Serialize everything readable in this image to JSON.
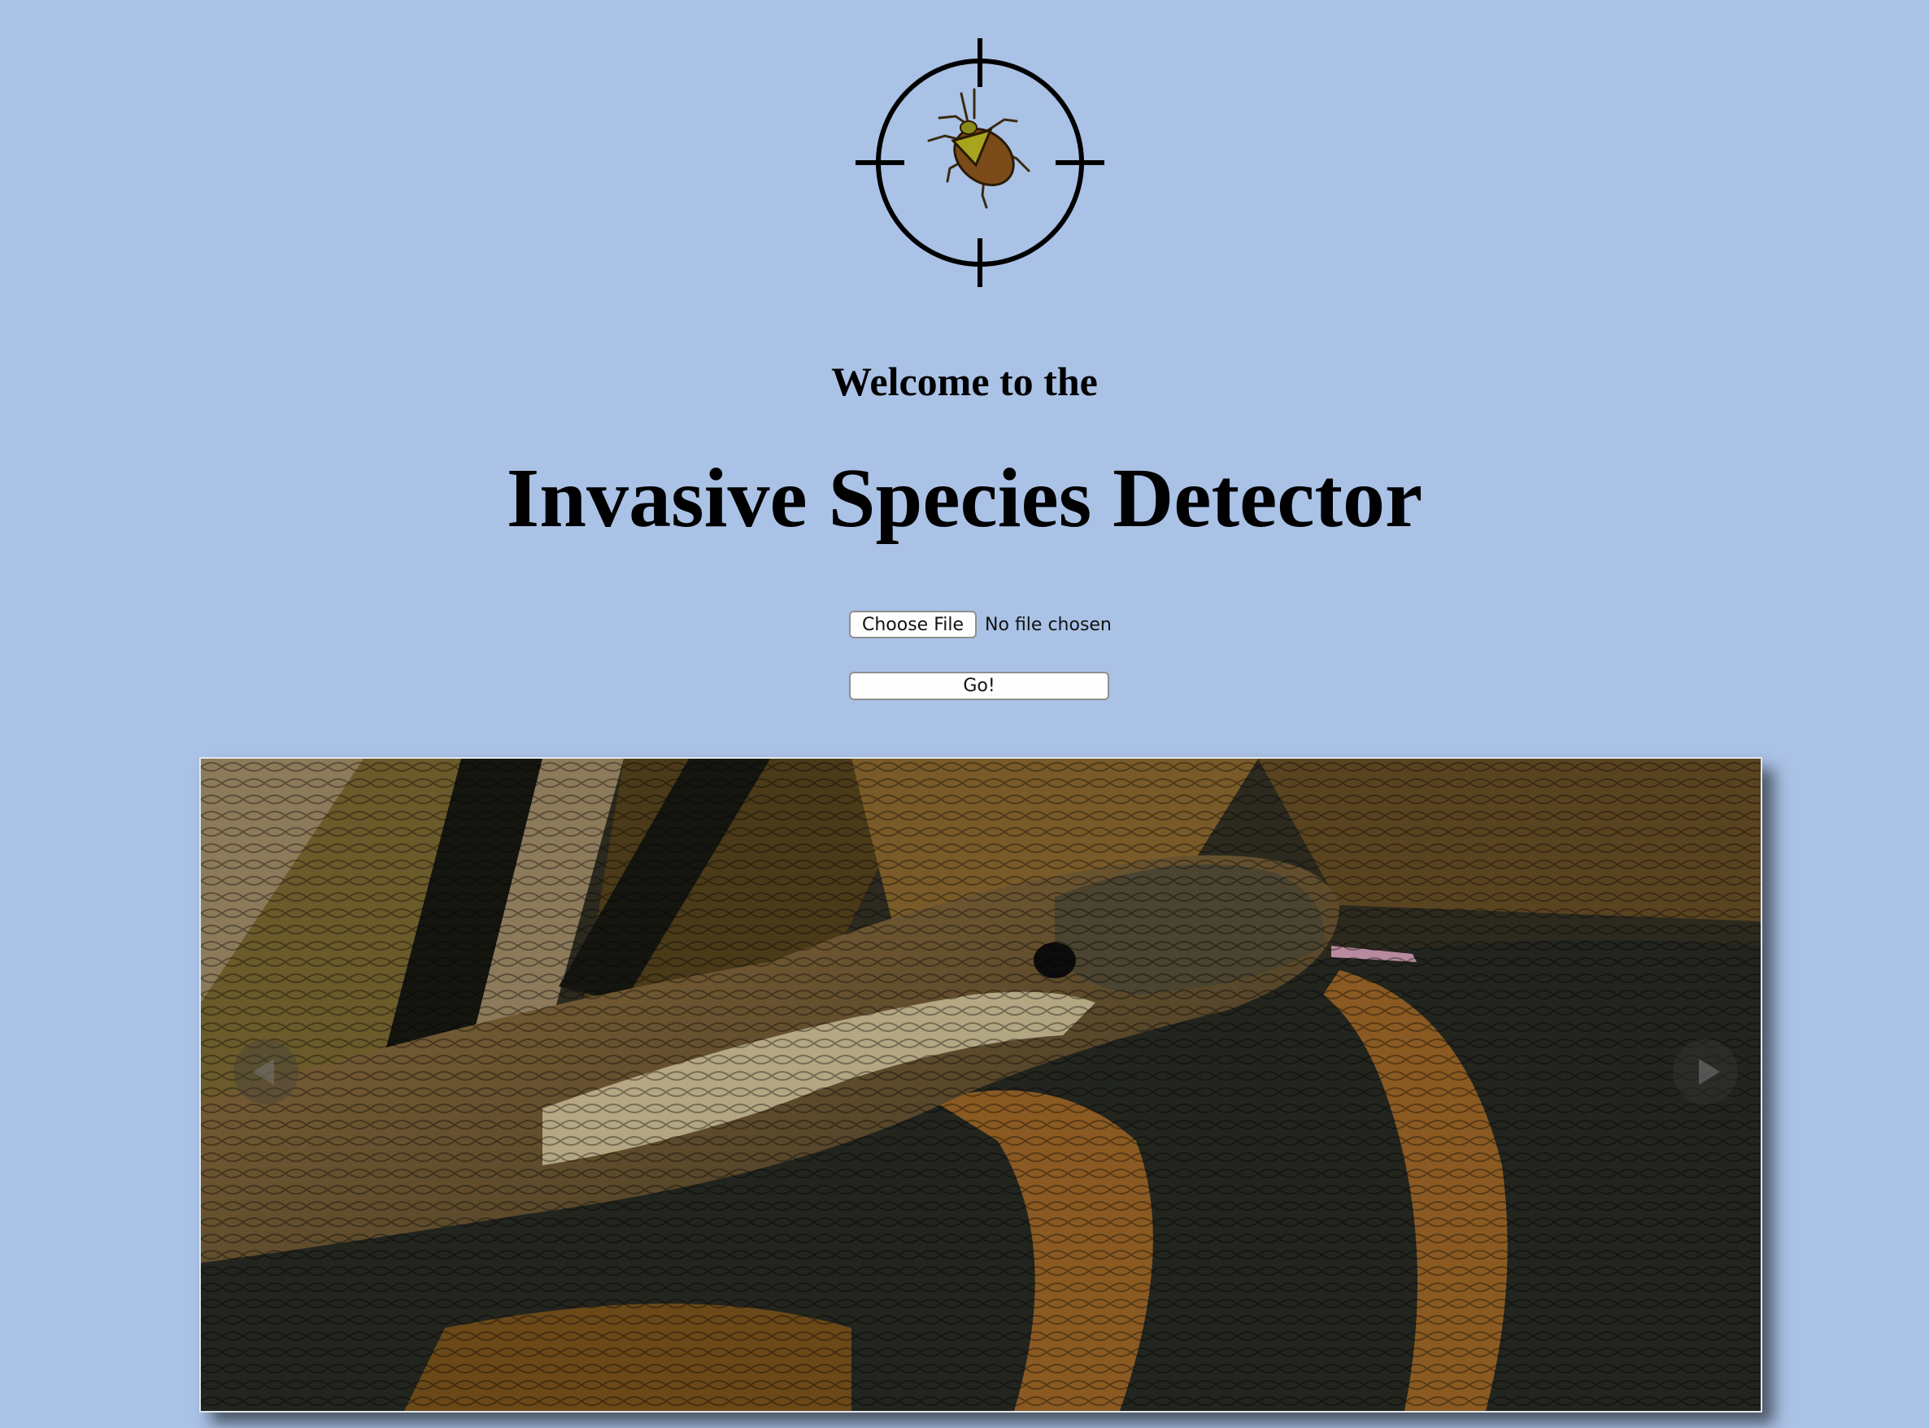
{
  "header": {
    "logo_icon": "bug-crosshair-icon",
    "welcome": "Welcome to the",
    "title": "Invasive Species Detector"
  },
  "upload": {
    "choose_label": "Choose File",
    "file_status": "No file chosen",
    "go_label": "Go!"
  },
  "slideshow": {
    "image_subject": "python-snake-photo",
    "prev_icon": "chevron-left-icon",
    "next_icon": "chevron-right-icon"
  },
  "colors": {
    "background": "#aac2e6",
    "text": "#000000"
  }
}
